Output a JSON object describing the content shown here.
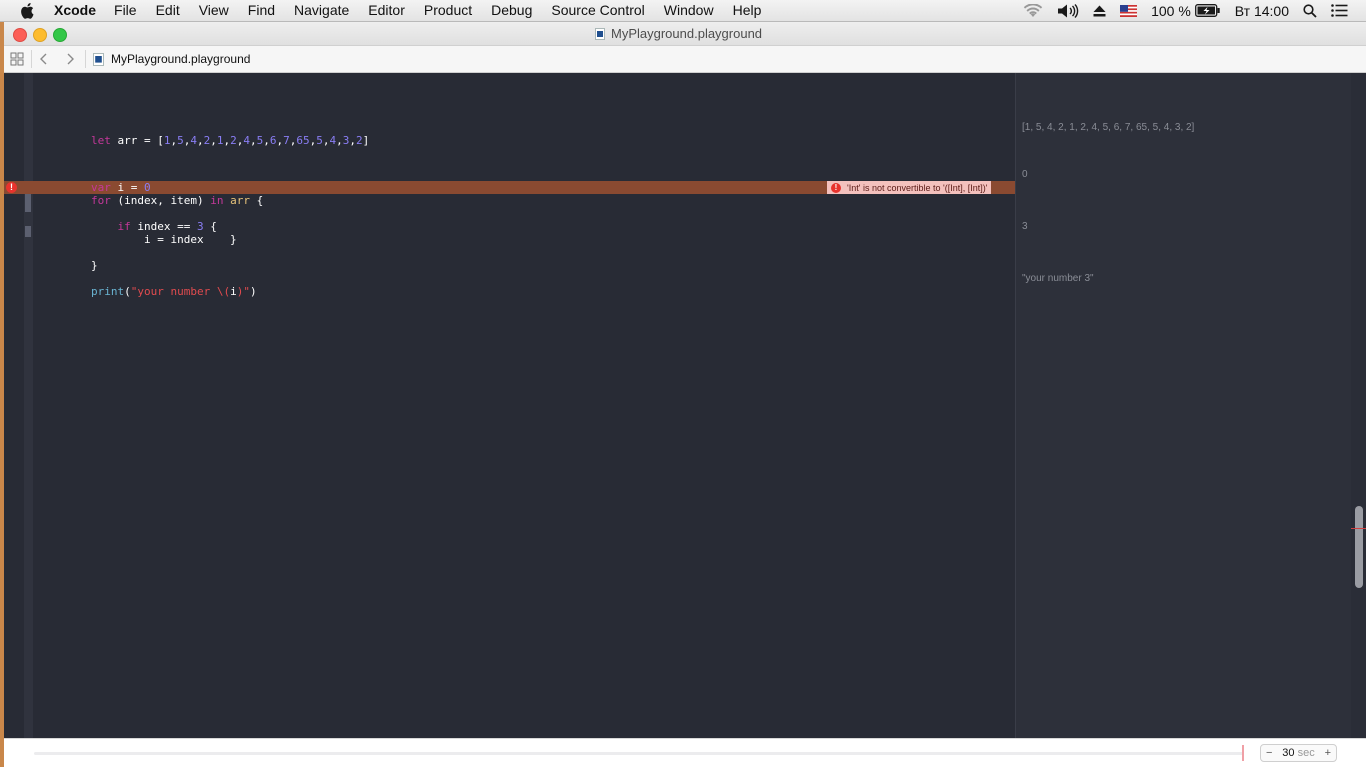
{
  "menubar": {
    "app_name": "Xcode",
    "items": [
      "File",
      "Edit",
      "View",
      "Find",
      "Navigate",
      "Editor",
      "Product",
      "Debug",
      "Source Control",
      "Window",
      "Help"
    ],
    "battery": "100 %",
    "clock": "Вт 14:00"
  },
  "window": {
    "title": "MyPlayground.playground",
    "jump_file": "MyPlayground.playground"
  },
  "code": {
    "line1": [
      "let",
      " arr = [",
      "1",
      ",",
      "5",
      ",",
      "4",
      ",",
      "2",
      ",",
      "1",
      ",",
      "2",
      ",",
      "4",
      ",",
      "5",
      ",",
      "6",
      ",",
      "7",
      ",",
      "65",
      ",",
      "5",
      ",",
      "4",
      ",",
      "3",
      ",",
      "2",
      "]"
    ],
    "line2_kw": "var",
    "line2_mid": " i = ",
    "line2_num": "0",
    "line3_kw": "for",
    "line3_mid": " (index, item) ",
    "line3_in": "in",
    "line3_arr": " arr",
    "line3_end": " {",
    "line4_kw": "    if",
    "line4_mid": " index == ",
    "line4_num": "3",
    "line4_end": " {",
    "line5": "        i = index    }",
    "line6": "}",
    "line7_fn": "print",
    "line7_paren": "(",
    "line7_str1": "\"your number \\(",
    "line7_var": "i",
    "line7_str2": ")\"",
    "line7_close": ")"
  },
  "error": {
    "marker": "!",
    "message": "'Int' is not convertible to '([Int], [Int])'"
  },
  "results": {
    "arr": "[1, 5, 4, 2, 1, 2, 4, 5, 6, 7, 65, 5, 4, 3, 2]",
    "i": "0",
    "assign": "3",
    "print": "\"your number 3\""
  },
  "timeline": {
    "minus": "−",
    "value": "30",
    "unit": "sec",
    "plus": "+"
  }
}
